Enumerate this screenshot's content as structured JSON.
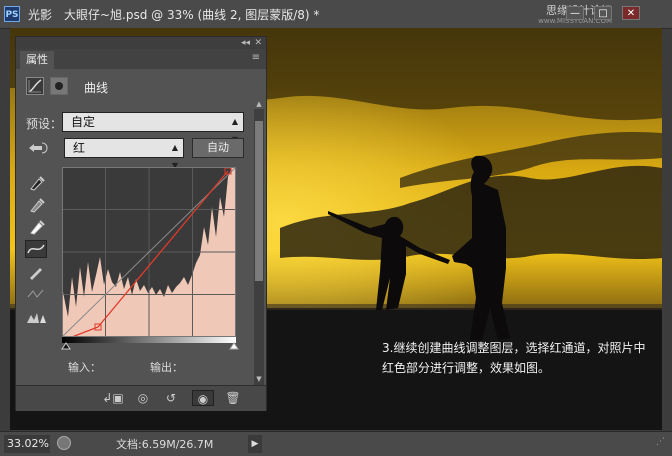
{
  "window": {
    "app_icon": "PS",
    "title": "光影　大眼仔~旭.psd @ 33% (曲线 2, 图层蒙版/8) *",
    "watermark": "思缘设计论坛",
    "watermark_url": "www.MISSYUAN.COM",
    "minimize": "—",
    "maximize": "□",
    "close": "✕"
  },
  "panel": {
    "collapse": "◂◂",
    "close": "✕",
    "tab": "属性",
    "menu": "≡",
    "adjustment_name": "曲线",
    "preset_label": "预设：",
    "preset_value": "自定",
    "channel_value": "红",
    "auto_button": "自动",
    "input_label": "输入：",
    "output_label": "输出："
  },
  "caption": "3.继续创建曲线调整图层，选择红通道，对照片中红色部分进行调整，效果如图。",
  "status": {
    "zoom": "33.02%",
    "doc_info": "文档:6.59M/26.7M",
    "arrow": "▶"
  },
  "icons": {
    "curves": "curves-icon",
    "mask": "mask-icon",
    "hand": "target-adjust-icon",
    "eye": "eye-icon",
    "trash": "trash-icon"
  }
}
